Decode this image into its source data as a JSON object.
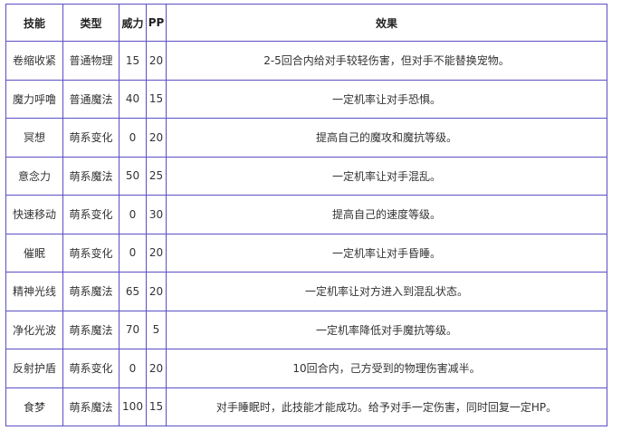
{
  "columns": [
    "技能",
    "类型",
    "威力",
    "PP",
    "效果"
  ],
  "rows": [
    {
      "skill": "卷缩收紧",
      "type": "普通物理",
      "power": "15",
      "pp": "20",
      "effect": "2-5回合内给对手较轻伤害，但对手不能替换宠物。"
    },
    {
      "skill": "魔力呼噜",
      "type": "普通魔法",
      "power": "40",
      "pp": "15",
      "effect": "一定机率让对手恐惧。"
    },
    {
      "skill": "冥想",
      "type": "萌系变化",
      "power": "0",
      "pp": "20",
      "effect": "提高自己的魔攻和魔抗等级。"
    },
    {
      "skill": "意念力",
      "type": "萌系魔法",
      "power": "50",
      "pp": "25",
      "effect": "一定机率让对手混乱。"
    },
    {
      "skill": "快速移动",
      "type": "萌系变化",
      "power": "0",
      "pp": "30",
      "effect": "提高自己的速度等级。"
    },
    {
      "skill": "催眠",
      "type": "萌系变化",
      "power": "0",
      "pp": "20",
      "effect": "一定机率让对手昏睡。"
    },
    {
      "skill": "精神光线",
      "type": "萌系魔法",
      "power": "65",
      "pp": "20",
      "effect": "一定机率让对方进入到混乱状态。"
    },
    {
      "skill": "净化光波",
      "type": "萌系魔法",
      "power": "70",
      "pp": "5",
      "effect": "一定机率降低对手魔抗等级。"
    },
    {
      "skill": "反射护盾",
      "type": "萌系变化",
      "power": "0",
      "pp": "20",
      "effect": "10回合内，己方受到的物理伤害减半。"
    },
    {
      "skill": "食梦",
      "type": "萌系魔法",
      "power": "100",
      "pp": "15",
      "effect": "对手睡眠时，此技能才能成功。给予对手一定伤害，同时回复一定HP。"
    }
  ],
  "colors": {
    "border": "#5b4fc4",
    "text": "#333333"
  }
}
